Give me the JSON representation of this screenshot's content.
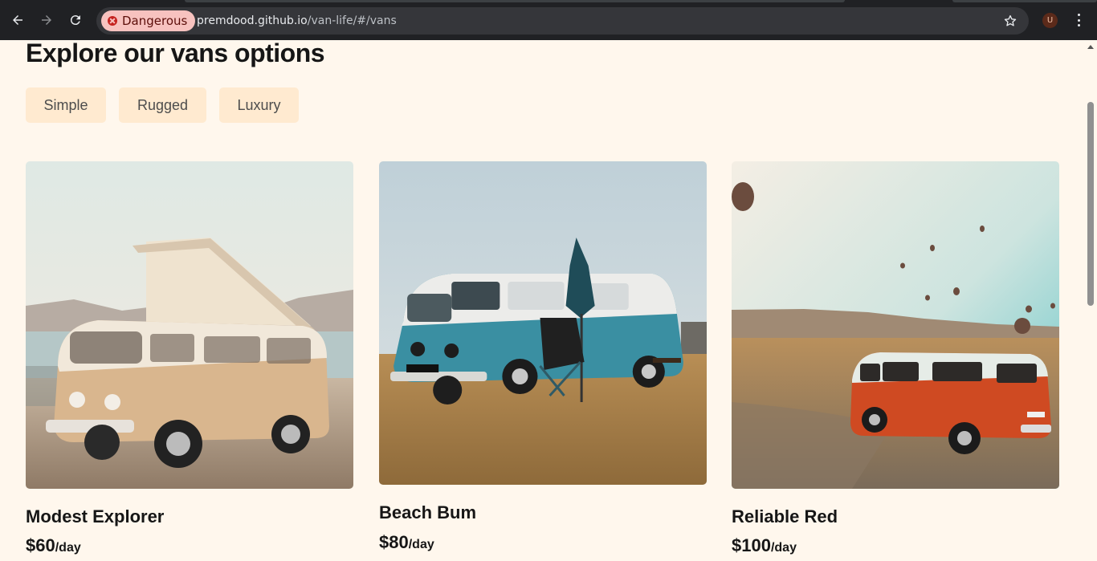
{
  "browser": {
    "security_label": "Dangerous",
    "url_host": "premdood.github.io",
    "url_path": "/van-life/#/vans",
    "profile_initial": "U"
  },
  "page": {
    "title": "Explore our vans options",
    "filters": [
      "Simple",
      "Rugged",
      "Luxury"
    ]
  },
  "vans": [
    {
      "name": "Modest Explorer",
      "price": "$60",
      "unit": "/day",
      "image": "beige-vw-camper-photo"
    },
    {
      "name": "Beach Bum",
      "price": "$80",
      "unit": "/day",
      "image": "teal-vw-bus-photo"
    },
    {
      "name": "Reliable Red",
      "price": "$100",
      "unit": "/day",
      "image": "red-vw-bus-photo"
    }
  ],
  "colors": {
    "page_bg": "#FFF7ED",
    "filter_bg": "#FFEAD0",
    "danger_chip_bg": "#F7C2BF"
  }
}
